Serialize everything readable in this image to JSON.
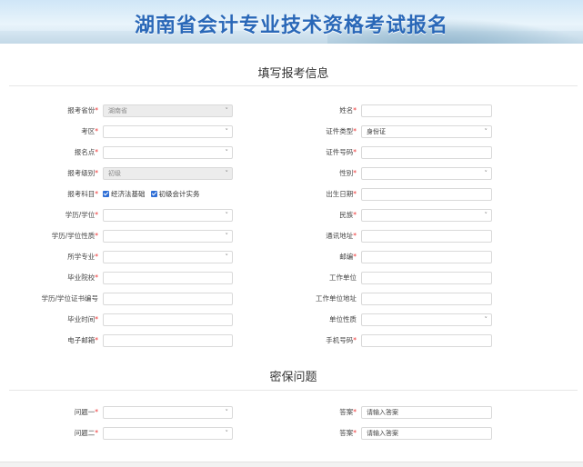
{
  "banner": {
    "title": "湖南省会计专业技术资格考试报名"
  },
  "section1": {
    "title": "填写报考信息"
  },
  "section2": {
    "title": "密保问题"
  },
  "left_fields": [
    {
      "label": "报考省份",
      "required": true,
      "type": "select",
      "value": "湖南省",
      "disabled": true
    },
    {
      "label": "考区",
      "required": true,
      "type": "select",
      "value": "",
      "disabled": false
    },
    {
      "label": "报名点",
      "required": true,
      "type": "select",
      "value": "",
      "disabled": false
    },
    {
      "label": "报考级别",
      "required": true,
      "type": "select",
      "value": "初级",
      "disabled": true
    },
    {
      "label": "报考科目",
      "required": true,
      "type": "checks",
      "options": [
        "经济法基础",
        "初级会计实务"
      ]
    },
    {
      "label": "学历/学位",
      "required": true,
      "type": "select",
      "value": "",
      "disabled": false
    },
    {
      "label": "学历/学位性质",
      "required": true,
      "type": "select",
      "value": "",
      "disabled": false
    },
    {
      "label": "所学专业",
      "required": true,
      "type": "select",
      "value": "",
      "disabled": false
    },
    {
      "label": "毕业院校",
      "required": true,
      "type": "input",
      "value": ""
    },
    {
      "label": "学历/学位证书编号",
      "required": false,
      "type": "input",
      "value": ""
    },
    {
      "label": "毕业时间",
      "required": true,
      "type": "input",
      "value": ""
    },
    {
      "label": "电子邮箱",
      "required": true,
      "type": "input",
      "value": ""
    }
  ],
  "right_fields": [
    {
      "label": "姓名",
      "required": true,
      "type": "input",
      "value": ""
    },
    {
      "label": "证件类型",
      "required": true,
      "type": "select",
      "value": "身份证",
      "disabled": false
    },
    {
      "label": "证件号码",
      "required": true,
      "type": "input",
      "value": ""
    },
    {
      "label": "性别",
      "required": true,
      "type": "select",
      "value": "",
      "disabled": false
    },
    {
      "label": "出生日期",
      "required": true,
      "type": "input",
      "value": ""
    },
    {
      "label": "民族",
      "required": true,
      "type": "select",
      "value": "",
      "disabled": false
    },
    {
      "label": "通讯地址",
      "required": true,
      "type": "input",
      "value": ""
    },
    {
      "label": "邮编",
      "required": true,
      "type": "input",
      "value": ""
    },
    {
      "label": "工作单位",
      "required": false,
      "type": "input",
      "value": ""
    },
    {
      "label": "工作单位地址",
      "required": false,
      "type": "input",
      "value": ""
    },
    {
      "label": "单位性质",
      "required": false,
      "type": "select",
      "value": "",
      "disabled": false
    },
    {
      "label": "手机号码",
      "required": true,
      "type": "input",
      "value": ""
    }
  ],
  "security_questions": [
    {
      "label": "问题一",
      "required": true,
      "value": "",
      "answer_label": "答案",
      "answer_placeholder": "请输入答案"
    },
    {
      "label": "问题二",
      "required": true,
      "value": "",
      "answer_label": "答案",
      "answer_placeholder": "请输入答案"
    }
  ],
  "required_mark": "*",
  "icons": {
    "select_arrow": "chevron-down-icon",
    "checkbox": "checkbox-checked-icon"
  },
  "colors": {
    "title_blue": "#2a68b8",
    "required_red": "#e33",
    "checkbox_blue": "#2f6fd6"
  }
}
